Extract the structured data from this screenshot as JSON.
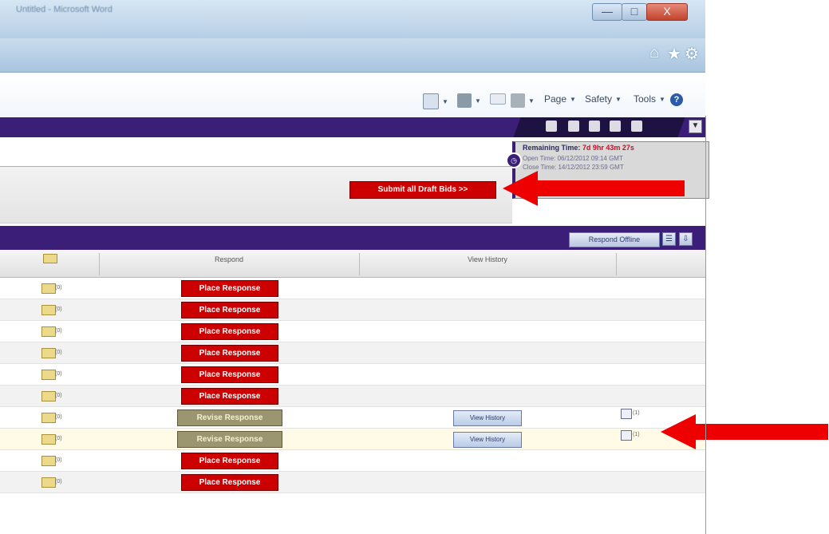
{
  "window": {
    "title": "Untitled - Microsoft Word",
    "controls": {
      "minimize": "—",
      "maximize": "□",
      "close": "X"
    }
  },
  "command_bar": {
    "page_label": "Page",
    "safety_label": "Safety",
    "tools_label": "Tools"
  },
  "timer": {
    "remaining_label": "Remaining Time:",
    "remaining_value": "7d 9hr 43m 27s",
    "open_label": "Open Time: 06/12/2012 09:14 GMT",
    "close_label": "Close Time: 14/12/2012 23:59 GMT"
  },
  "actions": {
    "submit_all": "Submit all Draft Bids >>"
  },
  "table": {
    "toolbar": {
      "respond_offline": "Respond Offline"
    },
    "columns": {
      "respond": "Respond",
      "view_history": "View History"
    },
    "rows": [
      {
        "response": "Place Response",
        "type": "place",
        "envelope_count": "(0)"
      },
      {
        "response": "Place Response",
        "type": "place",
        "envelope_count": "(0)"
      },
      {
        "response": "Place Response",
        "type": "place",
        "envelope_count": "(0)"
      },
      {
        "response": "Place Response",
        "type": "place",
        "envelope_count": "(0)"
      },
      {
        "response": "Place Response",
        "type": "place",
        "envelope_count": "(0)"
      },
      {
        "response": "Place Response",
        "type": "place",
        "envelope_count": "(0)"
      },
      {
        "response": "Revise Response",
        "type": "revise",
        "envelope_count": "(0)",
        "view_history": "View History",
        "doc_count": "(1)"
      },
      {
        "response": "Revise Response",
        "type": "revise",
        "envelope_count": "(0)",
        "view_history": "View History",
        "doc_count": "(1)",
        "highlight": true
      },
      {
        "response": "Place Response",
        "type": "place",
        "envelope_count": "(0)"
      },
      {
        "response": "Place Response",
        "type": "place",
        "envelope_count": "(0)"
      }
    ]
  },
  "colors": {
    "brand_purple": "#3a1e78",
    "action_red": "#cc0000",
    "revise_olive": "#9b9670",
    "annotation_red": "#ee0000"
  },
  "icons": [
    "home-icon",
    "star-icon",
    "gear-icon",
    "help-icon",
    "envelope-icon",
    "document-icon",
    "clock-icon"
  ]
}
